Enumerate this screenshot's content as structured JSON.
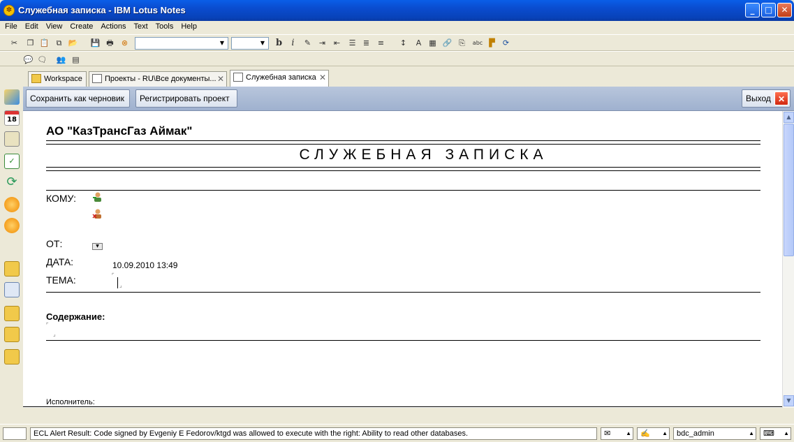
{
  "window": {
    "title": "Служебная записка - IBM Lotus Notes",
    "controls": {
      "minimize": "_",
      "maximize": "□",
      "close": "✕"
    }
  },
  "menu": [
    "File",
    "Edit",
    "View",
    "Create",
    "Actions",
    "Text",
    "Tools",
    "Help"
  ],
  "toolbar": {
    "icons": [
      "cut-icon",
      "copy-icon",
      "paste-icon",
      "copy-as-link-icon",
      "open-icon",
      "save-icon",
      "print-icon",
      "cancel-icon",
      "bold-icon",
      "italic-icon",
      "highlight-icon",
      "indent-icon",
      "outdent-icon",
      "bullets-icon",
      "numbers-icon",
      "align-icon",
      "spacing-icon",
      "text-color-icon",
      "table-icon",
      "link-icon",
      "attach-icon",
      "spellcheck-icon",
      "hotspot-icon",
      "refresh-icon"
    ],
    "bold_label": "b",
    "italic_label": "i",
    "spell_label": "abc"
  },
  "tabs": [
    {
      "label": "Workspace",
      "active": false
    },
    {
      "label": "Проекты - RU\\Все документы...",
      "active": false
    },
    {
      "label": "Служебная записка",
      "active": true
    }
  ],
  "actions": {
    "save_draft": "Сохранить как черновик",
    "register": "Регистрировать проект",
    "exit": "Выход"
  },
  "document": {
    "org": "АО \"КазТрансГаз Аймак\"",
    "heading": "СЛУЖЕБНАЯ ЗАПИСКА",
    "to_label": "КОМУ:",
    "from_label": "ОТ:",
    "date_label": "ДАТА:",
    "date_value": "10.09.2010 13:49",
    "subject_label": "ТЕМА:",
    "content_label": "Содержание:",
    "executor_label": "Исполнитель:",
    "field_start": "⌜",
    "field_end": "⌟"
  },
  "status": {
    "message": "ECL Alert Result: Code signed by Evgeniy E Fedorov/ktgd was allowed to execute with the right: Ability to read other databases.",
    "user": "bdc_admin"
  },
  "colors": {
    "titlebar": "#0a4ccf",
    "actionbar": "#9fb1cf",
    "exit_red": "#d02810"
  }
}
